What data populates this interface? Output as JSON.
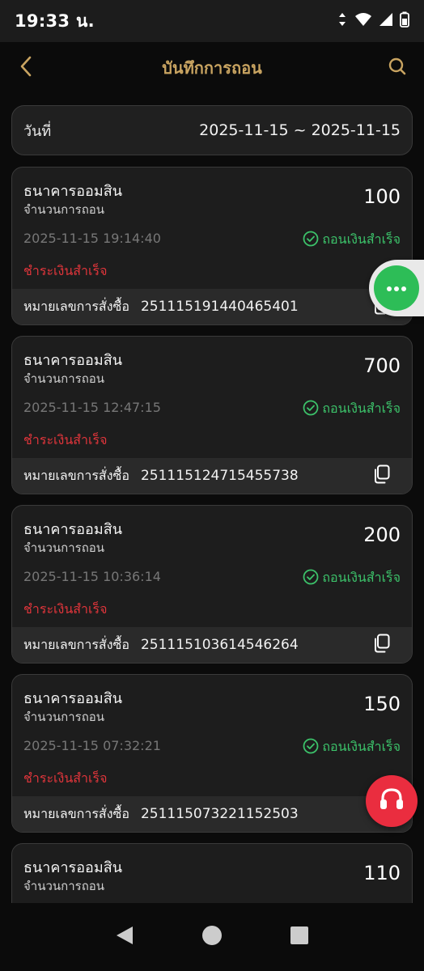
{
  "status_bar": {
    "time": "19:33 น."
  },
  "header": {
    "title": "บันทึกการถอน"
  },
  "date_filter": {
    "label": "วันที่",
    "range": "2025-11-15 ~ 2025-11-15"
  },
  "records": [
    {
      "bank": "ธนาคารออมสิน",
      "sub_label": "จำนวนการถอน",
      "amount": "100",
      "time": "2025-11-15 19:14:40",
      "status": "ถอนเงินสำเร็จ",
      "payment_status": "ชำระเงินสำเร็จ",
      "order_label": "หมายเลขการสั่งซื้อ",
      "order_no": "251115191440465401"
    },
    {
      "bank": "ธนาคารออมสิน",
      "sub_label": "จำนวนการถอน",
      "amount": "700",
      "time": "2025-11-15 12:47:15",
      "status": "ถอนเงินสำเร็จ",
      "payment_status": "ชำระเงินสำเร็จ",
      "order_label": "หมายเลขการสั่งซื้อ",
      "order_no": "251115124715455738"
    },
    {
      "bank": "ธนาคารออมสิน",
      "sub_label": "จำนวนการถอน",
      "amount": "200",
      "time": "2025-11-15 10:36:14",
      "status": "ถอนเงินสำเร็จ",
      "payment_status": "ชำระเงินสำเร็จ",
      "order_label": "หมายเลขการสั่งซื้อ",
      "order_no": "251115103614546264"
    },
    {
      "bank": "ธนาคารออมสิน",
      "sub_label": "จำนวนการถอน",
      "amount": "150",
      "time": "2025-11-15 07:32:21",
      "status": "ถอนเงินสำเร็จ",
      "payment_status": "ชำระเงินสำเร็จ",
      "order_label": "หมายเลขการสั่งซื้อ",
      "order_no": "251115073221152503"
    },
    {
      "bank": "ธนาคารออมสิน",
      "sub_label": "จำนวนการถอน",
      "amount": "110"
    }
  ],
  "colors": {
    "accent_gold": "#c9a461",
    "success_green": "#3cc26a",
    "payment_red": "#e0353b",
    "chat_green": "#2dbd57",
    "support_red": "#ea2d3f"
  },
  "icons": {
    "back": "chevron-left-icon",
    "search": "search-icon",
    "status": "check-circle-icon",
    "copy": "copy-icon",
    "chat": "chat-bubble-icon",
    "support": "headset-icon"
  }
}
